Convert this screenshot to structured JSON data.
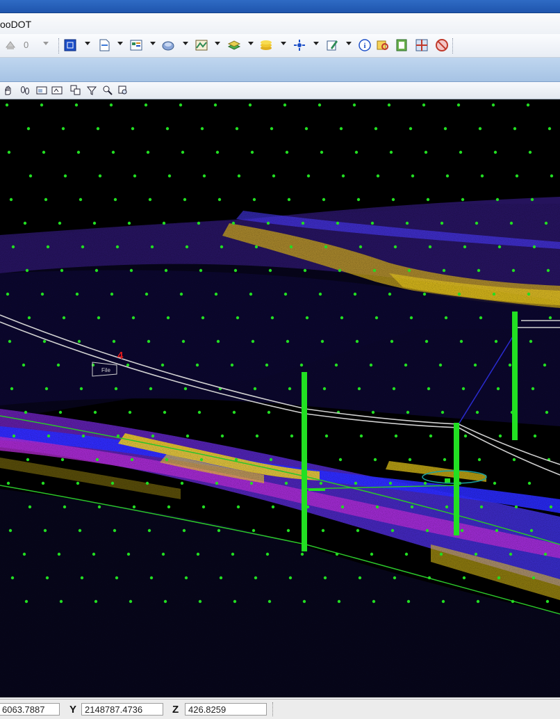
{
  "window": {
    "title_bar_color": "#1f55ad"
  },
  "menu": {
    "partial_item": "ooDOT"
  },
  "toolbar": {
    "disabled_value": "0",
    "icons": [
      "undo-icon",
      "box-view-icon",
      "new-document-icon",
      "properties-icon",
      "globe-icon",
      "map-icon",
      "layers-icon",
      "stack-icon",
      "snap-icon",
      "edit-icon",
      "info-icon",
      "search-icon",
      "export-icon",
      "grid-icon",
      "disable-icon"
    ]
  },
  "view_toolbar": {
    "icons": [
      "pan-hand-icon",
      "footsteps-icon",
      "view-window-icon",
      "view-previous-icon",
      "copy-view-icon",
      "filter-icon",
      "pick-icon",
      "settings-icon"
    ]
  },
  "viewport": {
    "annotation_label": "4",
    "file_tag": "File",
    "colors": {
      "background": "#000000",
      "points_green": "#22dd22",
      "pole_green": "#22e022",
      "cloud_blue": "#3b3bff",
      "cloud_purple": "#9b2fd6",
      "cloud_yellow": "#f2d21a",
      "wire_gray": "#cfcfcf"
    }
  },
  "status": {
    "x_value": "6063.7887",
    "y_label": "Y",
    "y_value": "2148787.4736",
    "z_label": "Z",
    "z_value": "426.8259"
  }
}
